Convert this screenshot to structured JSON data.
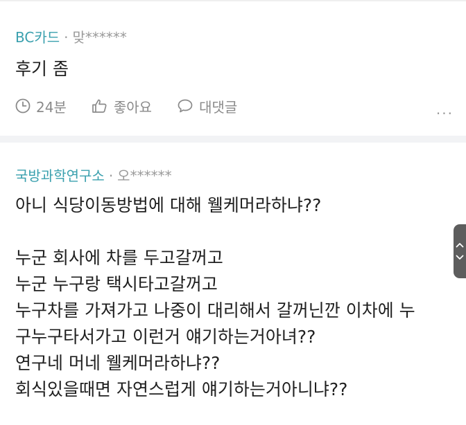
{
  "comments": [
    {
      "company": "BC카드",
      "separator": "·",
      "nickname": "맞******",
      "body": "후기 좀",
      "time": "24분",
      "like_label": "좋아요",
      "reply_label": "대댓글",
      "more_label": "..."
    },
    {
      "company": "국방과학연구소",
      "separator": "·",
      "nickname": "오******",
      "lines": [
        "아니 식당이동방법에 대해 웰케머라하냐??",
        "",
        "누군 회사에 차를 두고갈꺼고",
        "누군 누구랑 택시타고갈꺼고",
        "누구차를 가져가고 나중이 대리해서 갈꺼닌깐 이차에 누",
        "구누구타서가고 이런거 얘기하는거아녀??",
        "연구네 머네 웰케머라하냐??",
        "회식있을때면 자연스럽게 얘기하는거아니냐??"
      ]
    }
  ],
  "icons": {
    "time": "clock-icon",
    "like": "thumbs-up-icon",
    "reply": "speech-bubble-icon",
    "scroll": "chevron-up-down-icon"
  },
  "colors": {
    "company_accent": "#3aa0ae",
    "muted": "#9a9a9a",
    "separator_bg": "#f2f3f5"
  }
}
